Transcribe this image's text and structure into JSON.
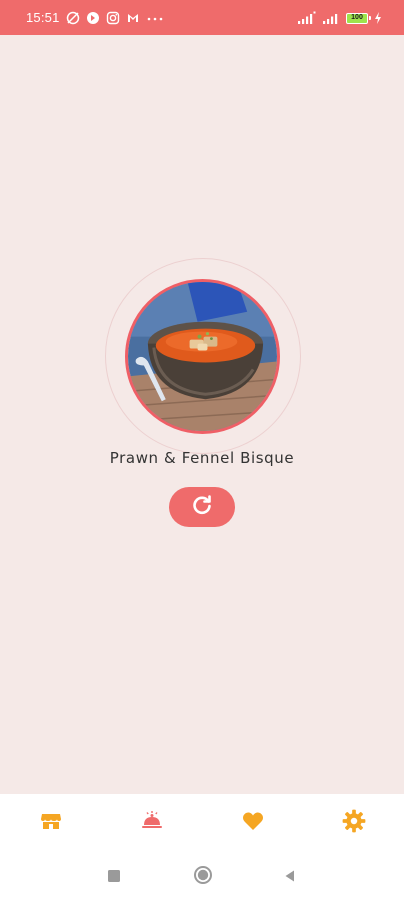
{
  "status_bar": {
    "time": "15:51",
    "battery_level": "100",
    "icons": [
      "slash-circle-icon",
      "circle-badge-icon",
      "instagram-icon",
      "mail-icon",
      "more-dots-icon",
      "signal-4g-icon",
      "signal-icon",
      "battery-icon",
      "charging-icon"
    ]
  },
  "meal": {
    "name": "Prawn & Fennel Bisque",
    "image_alt": "soup bowl photo"
  },
  "refresh": {
    "icon": "refresh-icon"
  },
  "bottom_nav": {
    "items": [
      {
        "icon": "storefront-icon",
        "color": "#f5a623"
      },
      {
        "icon": "cloche-icon",
        "color": "#ef6b6b"
      },
      {
        "icon": "heart-icon",
        "color": "#f5a623"
      },
      {
        "icon": "gear-icon",
        "color": "#f5a623"
      }
    ]
  },
  "system_nav": {
    "buttons": [
      "recent-apps-icon",
      "home-icon",
      "back-icon"
    ]
  },
  "colors": {
    "accent": "#ef6b6b",
    "background": "#f5e9e7",
    "nav_icon": "#f5a623"
  }
}
